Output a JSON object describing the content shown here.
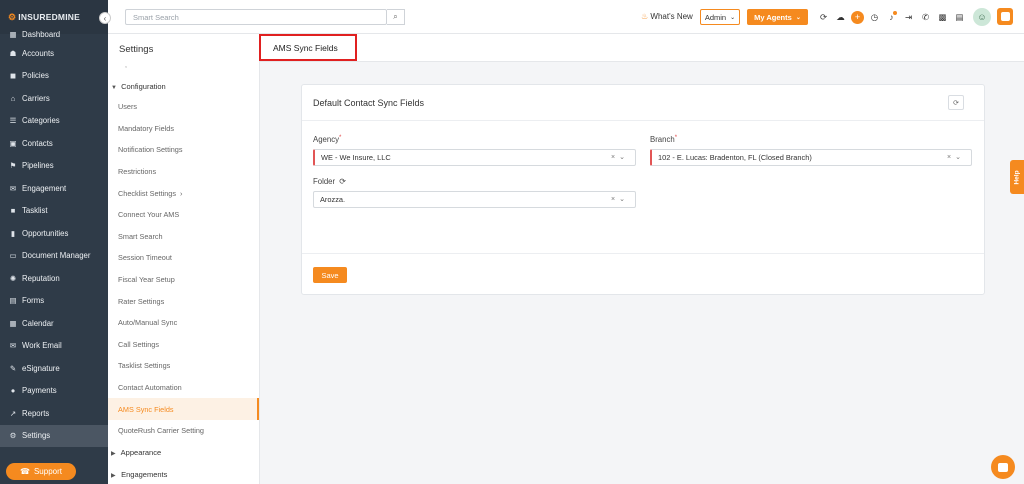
{
  "brand": {
    "name": "INSUREDMINE"
  },
  "sidebar": {
    "items": [
      {
        "label": "Dashboard",
        "icon": "dashboard-icon",
        "glyph": "▦"
      },
      {
        "label": "Accounts",
        "icon": "accounts-icon",
        "glyph": "☗"
      },
      {
        "label": "Policies",
        "icon": "policies-icon",
        "glyph": "◼"
      },
      {
        "label": "Carriers",
        "icon": "carriers-icon",
        "glyph": "⌂"
      },
      {
        "label": "Categories",
        "icon": "categories-icon",
        "glyph": "☰"
      },
      {
        "label": "Contacts",
        "icon": "contacts-icon",
        "glyph": "▣"
      },
      {
        "label": "Pipelines",
        "icon": "pipelines-icon",
        "glyph": "⚑"
      },
      {
        "label": "Engagement",
        "icon": "engagement-icon",
        "glyph": "✉"
      },
      {
        "label": "Tasklist",
        "icon": "tasklist-icon",
        "glyph": "■"
      },
      {
        "label": "Opportunities",
        "icon": "opportunities-icon",
        "glyph": "▮"
      },
      {
        "label": "Document Manager",
        "icon": "folder-icon",
        "glyph": "▭"
      },
      {
        "label": "Reputation",
        "icon": "reputation-icon",
        "glyph": "✺"
      },
      {
        "label": "Forms",
        "icon": "forms-icon",
        "glyph": "▤"
      },
      {
        "label": "Calendar",
        "icon": "calendar-icon",
        "glyph": "▦"
      },
      {
        "label": "Work Email",
        "icon": "email-icon",
        "glyph": "✉"
      },
      {
        "label": "eSignature",
        "icon": "signature-icon",
        "glyph": "✎"
      },
      {
        "label": "Payments",
        "icon": "payments-icon",
        "glyph": "●"
      },
      {
        "label": "Reports",
        "icon": "reports-icon",
        "glyph": "↗"
      },
      {
        "label": "Settings",
        "icon": "settings-icon",
        "glyph": "⚙"
      }
    ],
    "active": "Settings",
    "support_label": "Support"
  },
  "header": {
    "search_placeholder": "Smart Search",
    "whats_new": "What's New",
    "admin_label": "Admin",
    "agents_label": "My Agents"
  },
  "settings": {
    "title": "Settings",
    "configuration_label": "Configuration",
    "items": [
      "Users",
      "Mandatory Fields",
      "Notification Settings",
      "Restrictions",
      "Checklist Settings",
      "Connect Your AMS",
      "Smart Search",
      "Session Timeout",
      "Fiscal Year Setup",
      "Rater Settings",
      "Auto/Manual Sync",
      "Call Settings",
      "Tasklist Settings",
      "Contact Automation",
      "AMS Sync Fields",
      "QuoteRush Carrier Setting"
    ],
    "active_item": "AMS Sync Fields",
    "appearance_label": "Appearance",
    "engagements_label": "Engagements"
  },
  "page": {
    "title": "AMS Sync Fields",
    "card_title": "Default Contact Sync Fields",
    "agency_label": "Agency",
    "agency_value": "WE - We Insure, LLC",
    "branch_label": "Branch",
    "branch_value": "102 - E. Lucas: Bradenton, FL (Closed Branch)",
    "folder_label": "Folder",
    "folder_value": "Arozza.",
    "save_label": "Save"
  },
  "help_label": "Help",
  "colors": {
    "accent": "#f58a1f",
    "sidebar": "#2f3b48",
    "highlight": "#e02020"
  }
}
